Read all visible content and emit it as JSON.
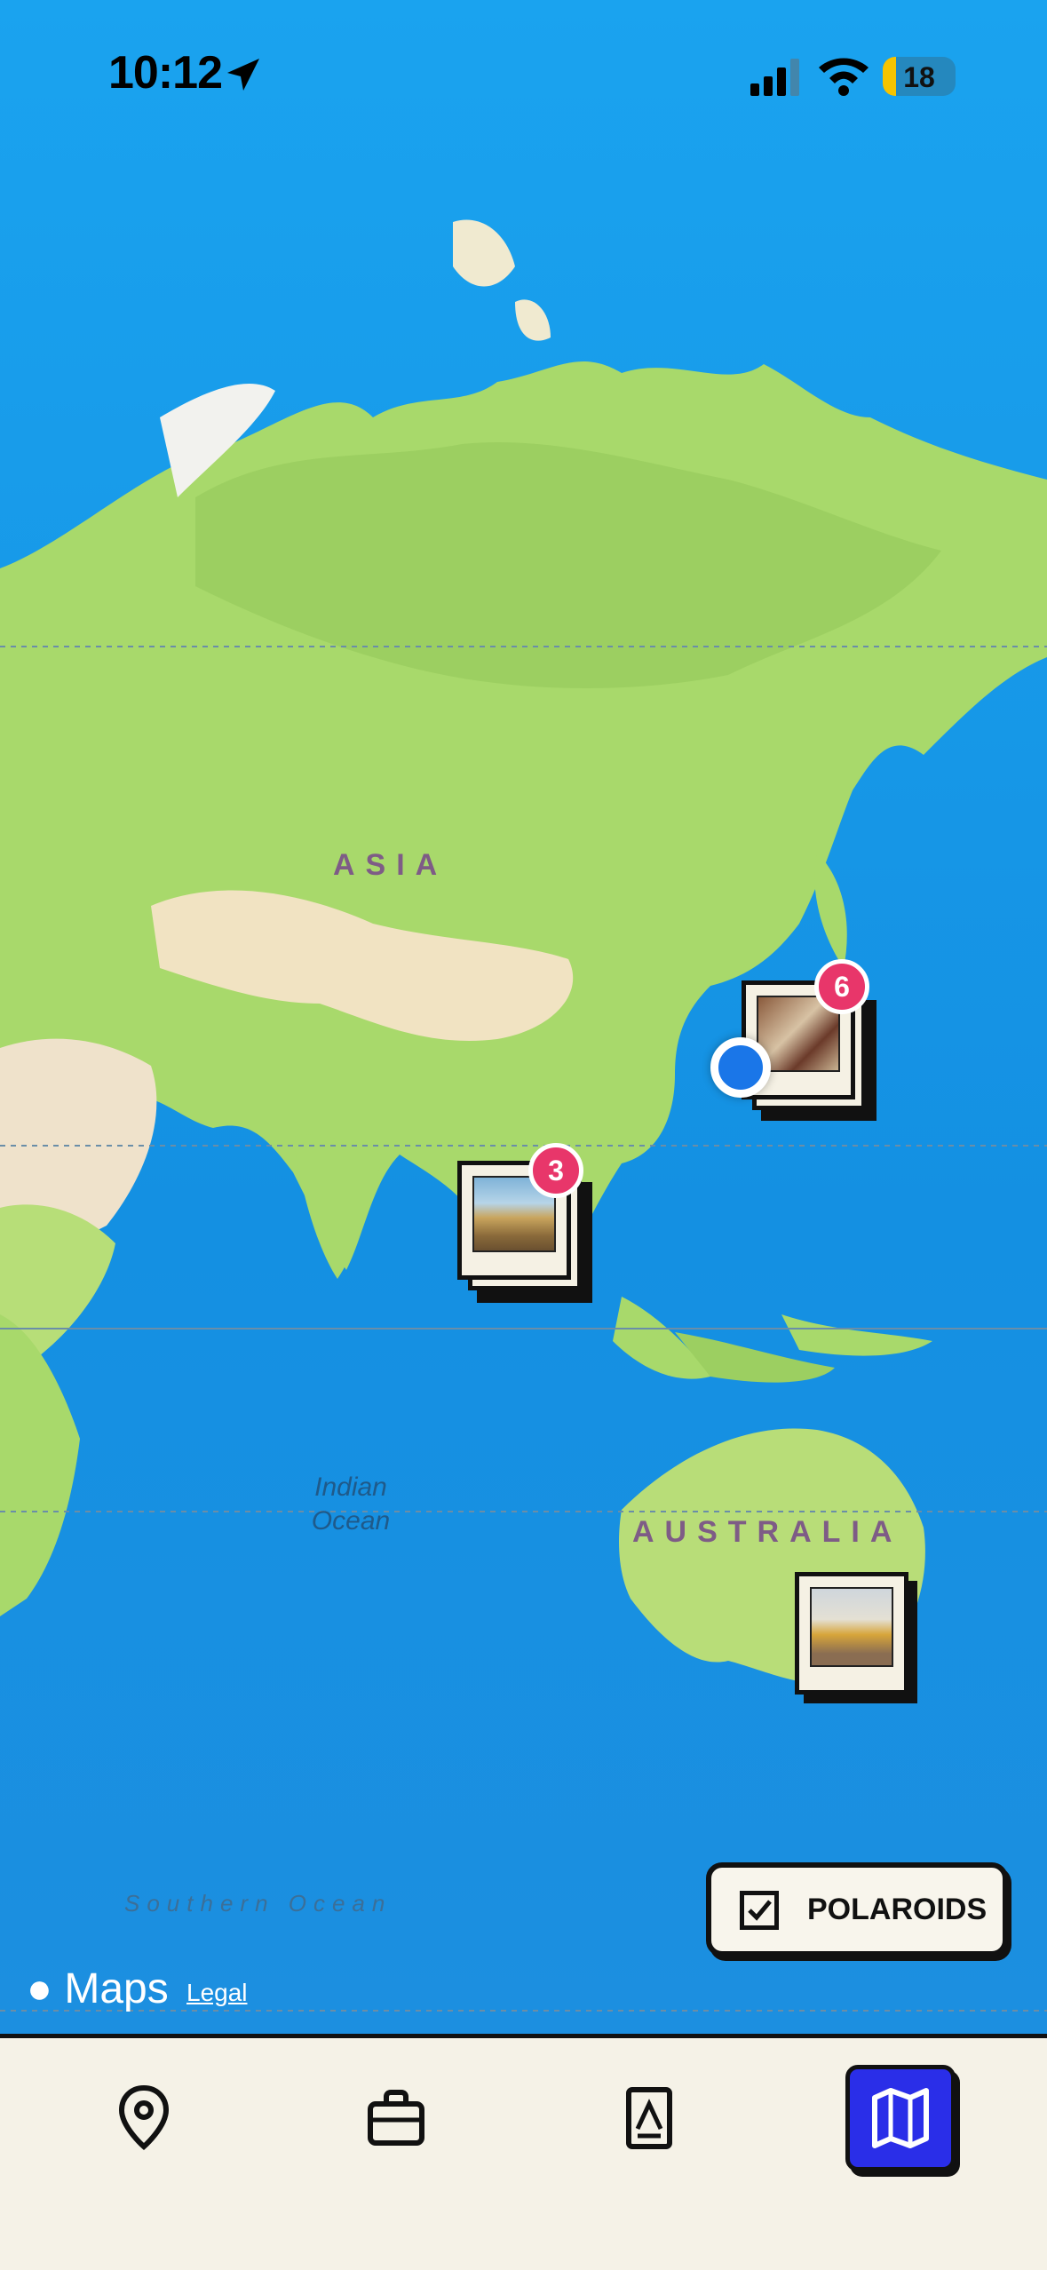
{
  "status_bar": {
    "time": "10:12",
    "battery": "18",
    "battery_level": 0.18
  },
  "map": {
    "labels": {
      "asia": "ASIA",
      "australia": "AUSTRALIA",
      "indian_ocean_line1": "Indian",
      "indian_ocean_line2": "Ocean",
      "southern_ocean": "Southern Ocean"
    },
    "attribution": {
      "maps": "Maps",
      "legal": "Legal"
    }
  },
  "markers": [
    {
      "count": "6"
    },
    {
      "count": "3"
    }
  ],
  "toggle": {
    "label": "POLAROIDS",
    "checked": true
  },
  "tabbar": {
    "items": [
      {
        "icon": "location-pin-icon"
      },
      {
        "icon": "briefcase-icon"
      },
      {
        "icon": "address-book-icon"
      },
      {
        "icon": "map-icon",
        "active": true
      }
    ]
  },
  "colors": {
    "accent": "#2a2ee8",
    "badge": "#e8366a",
    "ocean": "#1896e6",
    "land": "#a7d96c"
  }
}
